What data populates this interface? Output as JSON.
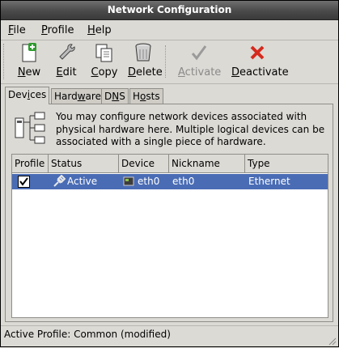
{
  "window": {
    "title": "Network Configuration"
  },
  "menu": [
    {
      "key": "file",
      "before": "",
      "accel": "F",
      "after": "ile"
    },
    {
      "key": "profile",
      "before": "",
      "accel": "P",
      "after": "rofile"
    },
    {
      "key": "help",
      "before": "",
      "accel": "H",
      "after": "elp"
    }
  ],
  "toolbar": {
    "new": {
      "accel": "N",
      "rest": "ew",
      "icon": "new-icon"
    },
    "edit": {
      "accel": "E",
      "rest": "dit",
      "icon": "edit-icon"
    },
    "copy": {
      "accel": "C",
      "rest": "opy",
      "icon": "copy-icon"
    },
    "delete": {
      "accel": "D",
      "rest": "elete",
      "icon": "delete-icon"
    },
    "activate": {
      "accel": "A",
      "rest": "ctivate",
      "icon": "activate-icon",
      "enabled": false
    },
    "deactivate": {
      "accel": "D",
      "rest": "eactivate",
      "icon": "deactivate-icon"
    }
  },
  "tabs": [
    {
      "id": "devices",
      "before": "Dev",
      "accel": "i",
      "after": "ces",
      "active": true
    },
    {
      "id": "hardware",
      "before": "Hard",
      "accel": "w",
      "after": "are",
      "active": false
    },
    {
      "id": "dns",
      "before": "D",
      "accel": "N",
      "after": "S",
      "active": false
    },
    {
      "id": "hosts",
      "before": "H",
      "accel": "o",
      "after": "sts",
      "active": false
    }
  ],
  "devices": {
    "description": "You may configure network devices associated with physical hardware here.  Multiple logical devices can be associated with a single piece of hardware.",
    "columns": [
      "Profile",
      "Status",
      "Device",
      "Nickname",
      "Type"
    ],
    "rows": [
      {
        "profile_checked": true,
        "status": "Active",
        "device": "eth0",
        "nickname": "eth0",
        "type": "Ethernet",
        "selected": true
      }
    ]
  },
  "statusbar": {
    "text": "Active Profile: Common (modified)"
  },
  "colors": {
    "selection": "#4a6cb5",
    "window_bg": "#dcdad5",
    "title_bg": "#4a4a4a"
  }
}
